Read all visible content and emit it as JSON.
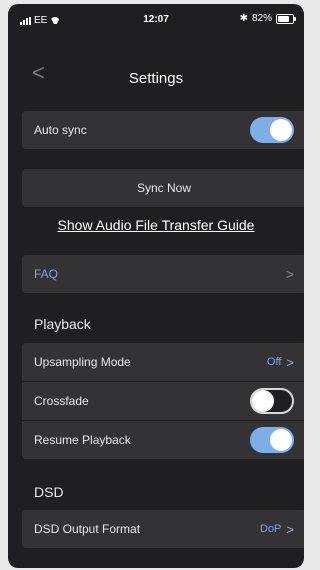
{
  "status_bar": {
    "carrier": "EE",
    "time": "12:07",
    "battery": "82%",
    "battery_level": 0.82,
    "icons": [
      "signal-bars-icon",
      "wifi-icon",
      "bluetooth-icon",
      "battery-icon"
    ]
  },
  "nav": {
    "back": "<",
    "title": "Settings"
  },
  "auto_sync": {
    "label": "Auto sync",
    "enabled": true
  },
  "sync_now": {
    "label": "Sync Now"
  },
  "guide_link": {
    "label": "Show Audio File Transfer Guide"
  },
  "faq": {
    "label": "FAQ",
    "chevron": ">"
  },
  "playback": {
    "heading": "Playback",
    "upsampling": {
      "label": "Upsampling Mode",
      "value": "Off",
      "chevron": ">"
    },
    "crossfade": {
      "label": "Crossfade",
      "enabled": false
    },
    "resume": {
      "label": "Resume Playback",
      "enabled": true
    }
  },
  "dsd": {
    "heading": "DSD",
    "output": {
      "label": "DSD Output Format",
      "value": "DoP",
      "chevron": ">"
    }
  },
  "colors": {
    "background": "#1f1f21",
    "row": "#333336",
    "toggle_on": "#7eaee6",
    "accent_text": "#7da3ee"
  }
}
